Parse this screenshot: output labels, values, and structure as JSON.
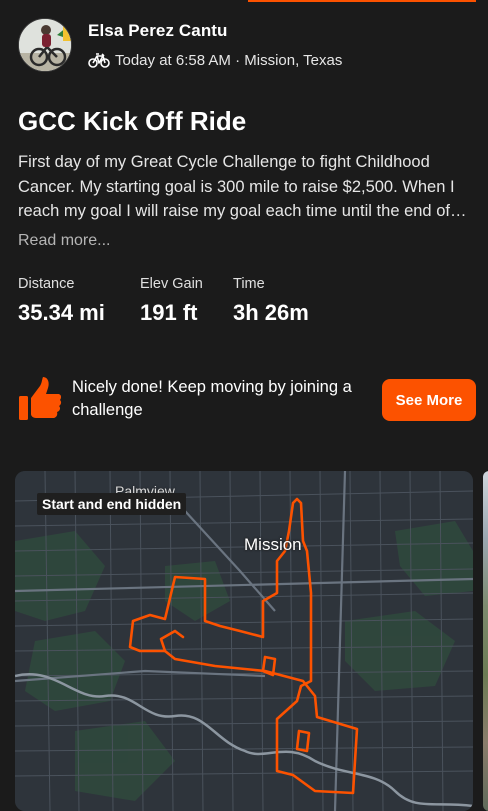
{
  "colors": {
    "background": "#1b1b1b",
    "accent": "#fc5200",
    "text_primary": "#ffffff",
    "text_secondary": "#b5b5b5",
    "map_route": "#fc5200"
  },
  "header": {
    "athlete_name": "Elsa Perez Cantu",
    "activity_icon": "bike-icon",
    "meta": "Today at 6:58 AM · Mission, Texas"
  },
  "activity": {
    "title": "GCC Kick Off Ride",
    "description": "First day of my Great Cycle Challenge to fight Childhood Cancer. My starting goal is 300 mile to raise $2,500. When I reach my goal I will raise my goal each time until the end of…",
    "read_more": "Read more..."
  },
  "stats": [
    {
      "label": "Distance",
      "value": "35.34 mi"
    },
    {
      "label": "Elev Gain",
      "value": "191 ft"
    },
    {
      "label": "Time",
      "value": "3h 26m"
    }
  ],
  "challenge_prompt": {
    "icon": "thumbs-up-icon",
    "text": "Nicely done! Keep moving by joining a challenge",
    "button_label": "See More"
  },
  "map": {
    "badge": "Start and end hidden",
    "labels": {
      "city": "Mission",
      "town": "Palmview"
    }
  }
}
